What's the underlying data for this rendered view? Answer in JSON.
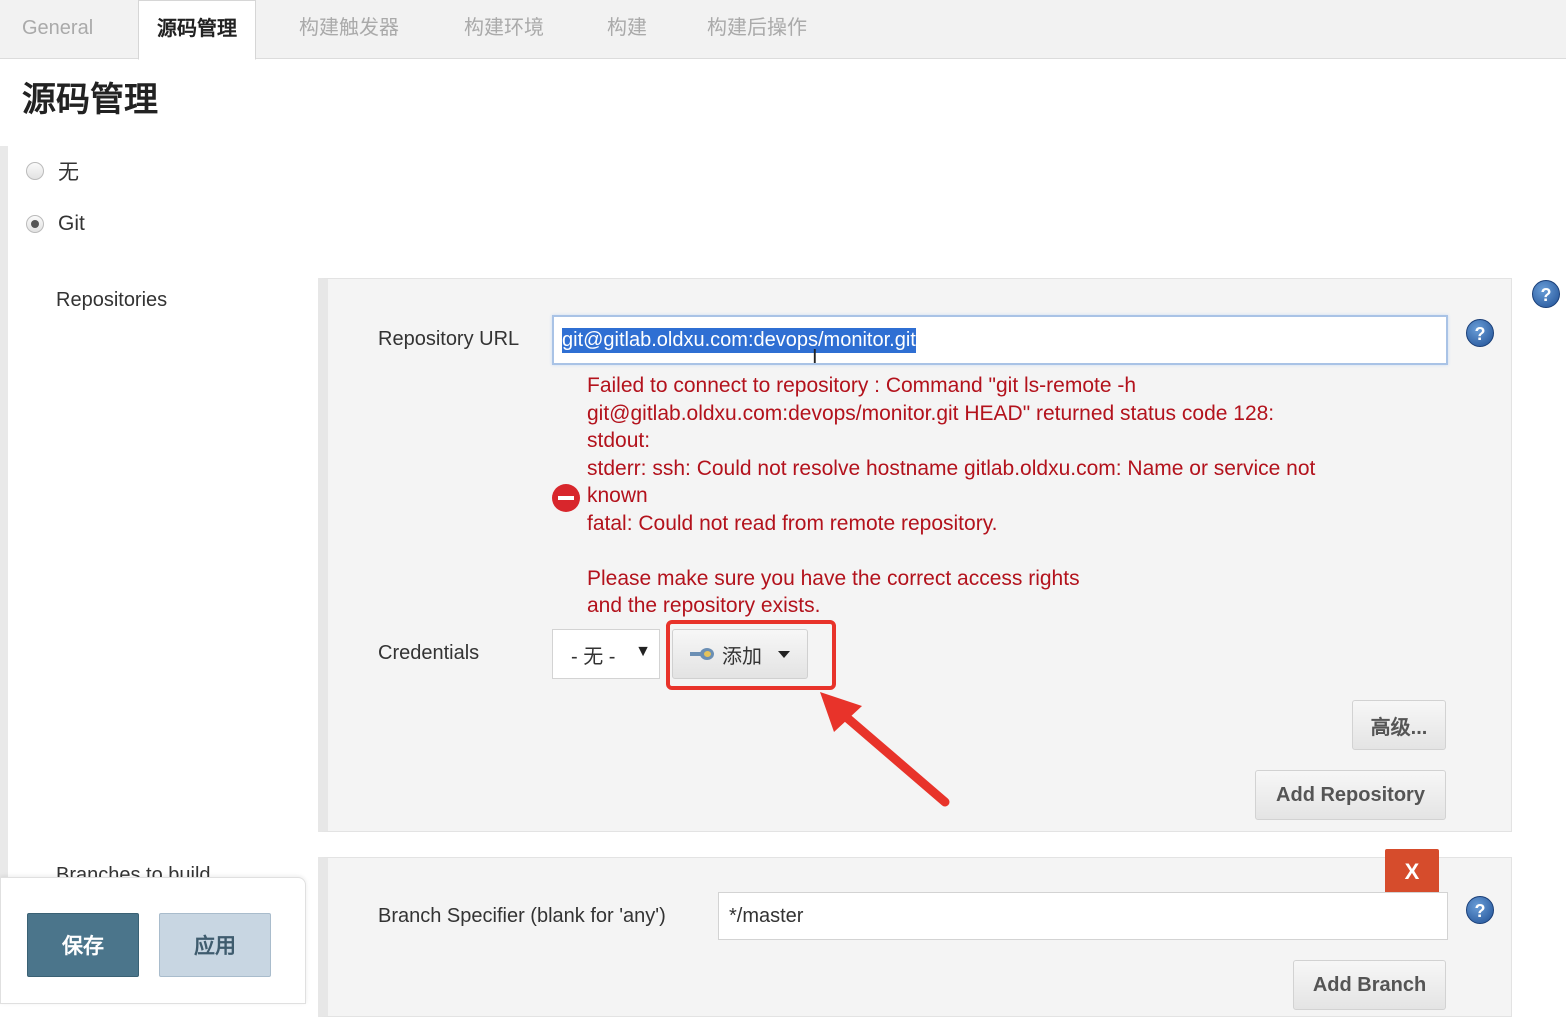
{
  "tabs": [
    {
      "label": "General",
      "active": false
    },
    {
      "label": "源码管理",
      "active": true
    },
    {
      "label": "构建触发器",
      "active": false
    },
    {
      "label": "构建环境",
      "active": false
    },
    {
      "label": "构建",
      "active": false
    },
    {
      "label": "构建后操作",
      "active": false
    }
  ],
  "section_title": "源码管理",
  "scm_options": [
    {
      "label": "无",
      "selected": false
    },
    {
      "label": "Git",
      "selected": true
    }
  ],
  "repositories": {
    "label": "Repositories",
    "url_label": "Repository URL",
    "url_value": "git@gitlab.oldxu.com:devops/monitor.git",
    "error_message": "Failed to connect to repository : Command \"git ls-remote -h\ngit@gitlab.oldxu.com:devops/monitor.git HEAD\" returned status code 128:\nstdout:\nstderr: ssh: Could not resolve hostname gitlab.oldxu.com: Name or service not\nknown\nfatal: Could not read from remote repository.\n\nPlease make sure you have the correct access rights\nand the repository exists.",
    "credentials_label": "Credentials",
    "credentials_value": "- 无 -",
    "add_button_label": "添加",
    "advanced_button_label": "高级...",
    "add_repository_label": "Add Repository"
  },
  "branches": {
    "label": "Branches to build",
    "delete_label": "X",
    "specifier_label": "Branch Specifier (blank for 'any')",
    "specifier_value": "*/master",
    "add_branch_label": "Add Branch"
  },
  "help_icon_glyph": "?",
  "footer": {
    "save_label": "保存",
    "apply_label": "应用"
  },
  "colors": {
    "error": "#b3121c",
    "save_button": "#4b758b",
    "apply_button": "#c8d6e2",
    "highlight": "#e8332a",
    "delete_button": "#d64c2c",
    "selection": "#2f6fd3"
  }
}
